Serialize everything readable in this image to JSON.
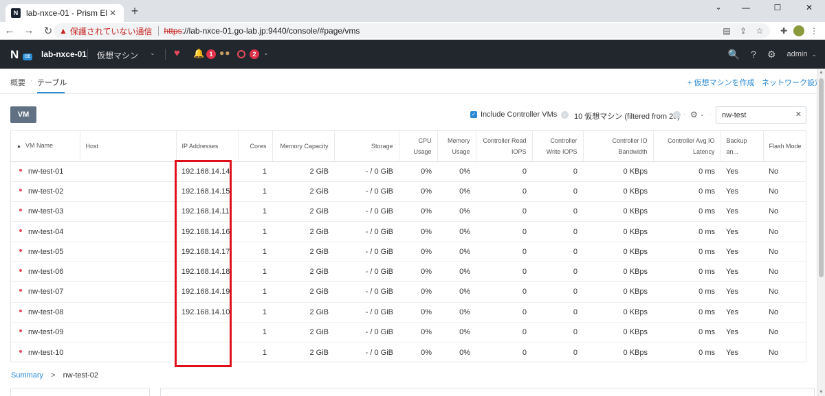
{
  "browser": {
    "tab_title": "lab-nxce-01 - Prism Element",
    "tab_favicon": "N",
    "close_glyph": "✕",
    "newtab_glyph": "+",
    "window": {
      "chevron": "⌄",
      "minimize": "—",
      "maximize": "☐",
      "close": "✕"
    },
    "nav": {
      "back": "←",
      "forward": "→",
      "reload": "↻"
    },
    "insecure_label": "保護されていない通信",
    "warning_glyph": "▲",
    "url_scheme": "https",
    "url_rest": "://lab-nxce-01.go-lab.jp:9440/console/#page/vms",
    "omni_icons": {
      "translate": "▤",
      "share": "⇪",
      "bookmark": "☆"
    },
    "tool_icons": {
      "extensions": "✚",
      "menu": "⋮"
    }
  },
  "prism": {
    "logo_letter": "N",
    "logo_badge": "CE",
    "cluster_name": "lab-nxce-01",
    "menu_label": "仮想マシン",
    "chevron": "⌄",
    "health_glyph": "♥",
    "bell_glyph": "🔔",
    "alert_count": "1",
    "alert_dots": "●●",
    "task_count": "2",
    "search_glyph": "🔍",
    "help_glyph": "?",
    "settings_glyph": "⚙",
    "user": "admin",
    "colors": {
      "header_bg": "#22272e",
      "alert": "#e84a5a",
      "accent": "#2a89d4"
    }
  },
  "subnav": {
    "overview": "概要",
    "separator": "·",
    "table": "テーブル",
    "create_vm": "+ 仮想マシンを作成",
    "network_settings": "ネットワーク設定"
  },
  "filter": {
    "vm_button": "VM",
    "check_glyph": "✓",
    "include_controller_label": "Include Controller VMs",
    "separator": "·",
    "prev_glyph": "‹",
    "next_glyph": "›",
    "count_text": "10 仮想マシン (filtered from 23)",
    "gear_glyph": "⚙",
    "gear_chevron": "⌄",
    "search_value": "nw-test",
    "clear_glyph": "✕"
  },
  "table": {
    "sort_glyph": "▲",
    "columns": [
      "VM Name",
      "Host",
      "IP Addresses",
      "Cores",
      "Memory Capacity",
      "Storage",
      "CPU Usage",
      "Memory Usage",
      "Controller Read IOPS",
      "Controller Write IOPS",
      "Controller IO Bandwidth",
      "Controller Avg IO Latency",
      "Backup an...",
      "Flash Mode"
    ],
    "rows": [
      [
        "nw-test-01",
        "",
        "192.168.14.14",
        "1",
        "2 GiB",
        "- / 0 GiB",
        "0%",
        "0%",
        "0",
        "0",
        "0 KBps",
        "0 ms",
        "Yes",
        "No"
      ],
      [
        "nw-test-02",
        "",
        "192.168.14.15",
        "1",
        "2 GiB",
        "- / 0 GiB",
        "0%",
        "0%",
        "0",
        "0",
        "0 KBps",
        "0 ms",
        "Yes",
        "No"
      ],
      [
        "nw-test-03",
        "",
        "192.168.14.11",
        "1",
        "2 GiB",
        "- / 0 GiB",
        "0%",
        "0%",
        "0",
        "0",
        "0 KBps",
        "0 ms",
        "Yes",
        "No"
      ],
      [
        "nw-test-04",
        "",
        "192.168.14.16",
        "1",
        "2 GiB",
        "- / 0 GiB",
        "0%",
        "0%",
        "0",
        "0",
        "0 KBps",
        "0 ms",
        "Yes",
        "No"
      ],
      [
        "nw-test-05",
        "",
        "192.168.14.17",
        "1",
        "2 GiB",
        "- / 0 GiB",
        "0%",
        "0%",
        "0",
        "0",
        "0 KBps",
        "0 ms",
        "Yes",
        "No"
      ],
      [
        "nw-test-06",
        "",
        "192.168.14.18",
        "1",
        "2 GiB",
        "- / 0 GiB",
        "0%",
        "0%",
        "0",
        "0",
        "0 KBps",
        "0 ms",
        "Yes",
        "No"
      ],
      [
        "nw-test-07",
        "",
        "192.168.14.19",
        "1",
        "2 GiB",
        "- / 0 GiB",
        "0%",
        "0%",
        "0",
        "0",
        "0 KBps",
        "0 ms",
        "Yes",
        "No"
      ],
      [
        "nw-test-08",
        "",
        "192.168.14.10",
        "1",
        "2 GiB",
        "- / 0 GiB",
        "0%",
        "0%",
        "0",
        "0",
        "0 KBps",
        "0 ms",
        "Yes",
        "No"
      ],
      [
        "nw-test-09",
        "",
        "",
        "1",
        "2 GiB",
        "- / 0 GiB",
        "0%",
        "0%",
        "0",
        "0",
        "0 KBps",
        "0 ms",
        "Yes",
        "No"
      ],
      [
        "nw-test-10",
        "",
        "",
        "1",
        "2 GiB",
        "- / 0 GiB",
        "0%",
        "0%",
        "0",
        "0",
        "0 KBps",
        "0 ms",
        "Yes",
        "No"
      ]
    ]
  },
  "summary": {
    "label": "Summary",
    "arrow": ">",
    "selected_vm": "nw-test-02"
  },
  "scrollbar": {
    "up": "▲",
    "down": "▼"
  }
}
